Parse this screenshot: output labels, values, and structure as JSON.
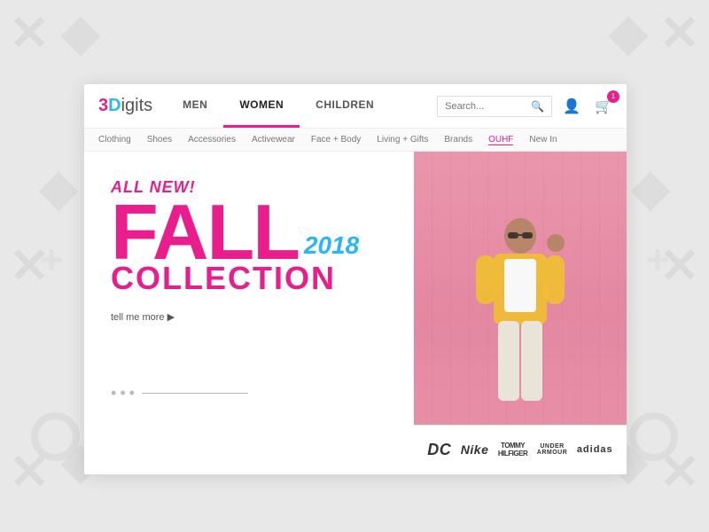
{
  "brand": {
    "name_3": "3",
    "name_d": "D",
    "name_igits": "igits",
    "logo_label": "3Digits"
  },
  "navbar": {
    "items": [
      {
        "label": "MEN",
        "active": false
      },
      {
        "label": "WOMEN",
        "active": true
      },
      {
        "label": "CHILDREN",
        "active": false
      }
    ],
    "search_placeholder": "Search...",
    "cart_count": "1"
  },
  "subnav": {
    "items": [
      {
        "label": "Clothing",
        "highlight": false
      },
      {
        "label": "Shoes",
        "highlight": false
      },
      {
        "label": "Accessories",
        "highlight": false
      },
      {
        "label": "Activewear",
        "highlight": false
      },
      {
        "label": "Face + Body",
        "highlight": false
      },
      {
        "label": "Living + Gifts",
        "highlight": false
      },
      {
        "label": "Brands",
        "highlight": false
      },
      {
        "label": "OUHF",
        "highlight": true
      },
      {
        "label": "New In",
        "highlight": false
      }
    ]
  },
  "hero": {
    "tag": "ALL NEW!",
    "title_main": "FALL",
    "year": "2018",
    "subtitle": "COLLECTION",
    "cta": "tell me more ▶"
  },
  "brands": [
    {
      "label": "DC",
      "class": "brand-dc"
    },
    {
      "label": "Nike",
      "class": "brand-nike"
    },
    {
      "label": "HILFIGER",
      "class": "brand-th"
    },
    {
      "label": "UNDER ARMOUR",
      "class": "brand-ua"
    },
    {
      "label": "adidas",
      "class": "brand-adidas"
    }
  ],
  "colors": {
    "pink": "#e91e8c",
    "blue": "#29b6f6",
    "dark": "#222222"
  }
}
